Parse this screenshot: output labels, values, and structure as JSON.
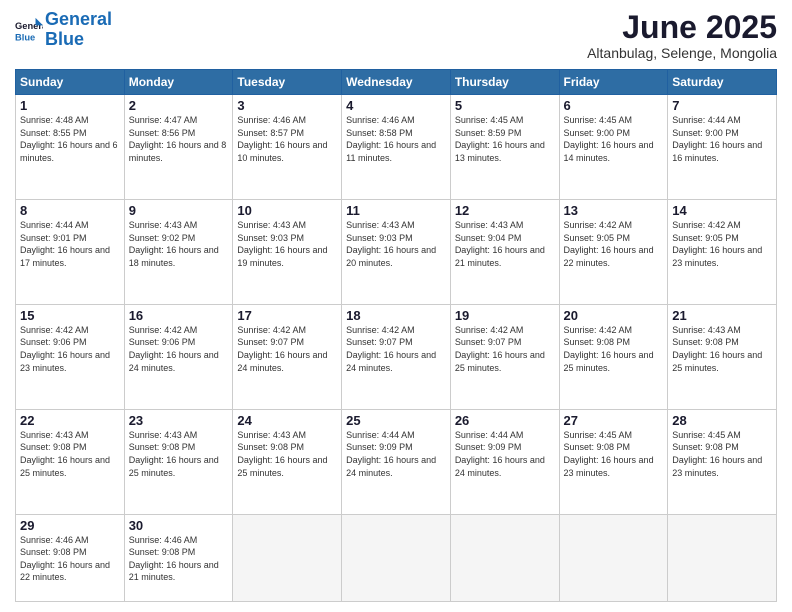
{
  "header": {
    "logo_line1": "General",
    "logo_line2": "Blue",
    "month_title": "June 2025",
    "location": "Altanbulag, Selenge, Mongolia"
  },
  "days_of_week": [
    "Sunday",
    "Monday",
    "Tuesday",
    "Wednesday",
    "Thursday",
    "Friday",
    "Saturday"
  ],
  "weeks": [
    [
      {
        "day": "1",
        "sunrise": "Sunrise: 4:48 AM",
        "sunset": "Sunset: 8:55 PM",
        "daylight": "Daylight: 16 hours and 6 minutes."
      },
      {
        "day": "2",
        "sunrise": "Sunrise: 4:47 AM",
        "sunset": "Sunset: 8:56 PM",
        "daylight": "Daylight: 16 hours and 8 minutes."
      },
      {
        "day": "3",
        "sunrise": "Sunrise: 4:46 AM",
        "sunset": "Sunset: 8:57 PM",
        "daylight": "Daylight: 16 hours and 10 minutes."
      },
      {
        "day": "4",
        "sunrise": "Sunrise: 4:46 AM",
        "sunset": "Sunset: 8:58 PM",
        "daylight": "Daylight: 16 hours and 11 minutes."
      },
      {
        "day": "5",
        "sunrise": "Sunrise: 4:45 AM",
        "sunset": "Sunset: 8:59 PM",
        "daylight": "Daylight: 16 hours and 13 minutes."
      },
      {
        "day": "6",
        "sunrise": "Sunrise: 4:45 AM",
        "sunset": "Sunset: 9:00 PM",
        "daylight": "Daylight: 16 hours and 14 minutes."
      },
      {
        "day": "7",
        "sunrise": "Sunrise: 4:44 AM",
        "sunset": "Sunset: 9:00 PM",
        "daylight": "Daylight: 16 hours and 16 minutes."
      }
    ],
    [
      {
        "day": "8",
        "sunrise": "Sunrise: 4:44 AM",
        "sunset": "Sunset: 9:01 PM",
        "daylight": "Daylight: 16 hours and 17 minutes."
      },
      {
        "day": "9",
        "sunrise": "Sunrise: 4:43 AM",
        "sunset": "Sunset: 9:02 PM",
        "daylight": "Daylight: 16 hours and 18 minutes."
      },
      {
        "day": "10",
        "sunrise": "Sunrise: 4:43 AM",
        "sunset": "Sunset: 9:03 PM",
        "daylight": "Daylight: 16 hours and 19 minutes."
      },
      {
        "day": "11",
        "sunrise": "Sunrise: 4:43 AM",
        "sunset": "Sunset: 9:03 PM",
        "daylight": "Daylight: 16 hours and 20 minutes."
      },
      {
        "day": "12",
        "sunrise": "Sunrise: 4:43 AM",
        "sunset": "Sunset: 9:04 PM",
        "daylight": "Daylight: 16 hours and 21 minutes."
      },
      {
        "day": "13",
        "sunrise": "Sunrise: 4:42 AM",
        "sunset": "Sunset: 9:05 PM",
        "daylight": "Daylight: 16 hours and 22 minutes."
      },
      {
        "day": "14",
        "sunrise": "Sunrise: 4:42 AM",
        "sunset": "Sunset: 9:05 PM",
        "daylight": "Daylight: 16 hours and 23 minutes."
      }
    ],
    [
      {
        "day": "15",
        "sunrise": "Sunrise: 4:42 AM",
        "sunset": "Sunset: 9:06 PM",
        "daylight": "Daylight: 16 hours and 23 minutes."
      },
      {
        "day": "16",
        "sunrise": "Sunrise: 4:42 AM",
        "sunset": "Sunset: 9:06 PM",
        "daylight": "Daylight: 16 hours and 24 minutes."
      },
      {
        "day": "17",
        "sunrise": "Sunrise: 4:42 AM",
        "sunset": "Sunset: 9:07 PM",
        "daylight": "Daylight: 16 hours and 24 minutes."
      },
      {
        "day": "18",
        "sunrise": "Sunrise: 4:42 AM",
        "sunset": "Sunset: 9:07 PM",
        "daylight": "Daylight: 16 hours and 24 minutes."
      },
      {
        "day": "19",
        "sunrise": "Sunrise: 4:42 AM",
        "sunset": "Sunset: 9:07 PM",
        "daylight": "Daylight: 16 hours and 25 minutes."
      },
      {
        "day": "20",
        "sunrise": "Sunrise: 4:42 AM",
        "sunset": "Sunset: 9:08 PM",
        "daylight": "Daylight: 16 hours and 25 minutes."
      },
      {
        "day": "21",
        "sunrise": "Sunrise: 4:43 AM",
        "sunset": "Sunset: 9:08 PM",
        "daylight": "Daylight: 16 hours and 25 minutes."
      }
    ],
    [
      {
        "day": "22",
        "sunrise": "Sunrise: 4:43 AM",
        "sunset": "Sunset: 9:08 PM",
        "daylight": "Daylight: 16 hours and 25 minutes."
      },
      {
        "day": "23",
        "sunrise": "Sunrise: 4:43 AM",
        "sunset": "Sunset: 9:08 PM",
        "daylight": "Daylight: 16 hours and 25 minutes."
      },
      {
        "day": "24",
        "sunrise": "Sunrise: 4:43 AM",
        "sunset": "Sunset: 9:08 PM",
        "daylight": "Daylight: 16 hours and 25 minutes."
      },
      {
        "day": "25",
        "sunrise": "Sunrise: 4:44 AM",
        "sunset": "Sunset: 9:09 PM",
        "daylight": "Daylight: 16 hours and 24 minutes."
      },
      {
        "day": "26",
        "sunrise": "Sunrise: 4:44 AM",
        "sunset": "Sunset: 9:09 PM",
        "daylight": "Daylight: 16 hours and 24 minutes."
      },
      {
        "day": "27",
        "sunrise": "Sunrise: 4:45 AM",
        "sunset": "Sunset: 9:08 PM",
        "daylight": "Daylight: 16 hours and 23 minutes."
      },
      {
        "day": "28",
        "sunrise": "Sunrise: 4:45 AM",
        "sunset": "Sunset: 9:08 PM",
        "daylight": "Daylight: 16 hours and 23 minutes."
      }
    ],
    [
      {
        "day": "29",
        "sunrise": "Sunrise: 4:46 AM",
        "sunset": "Sunset: 9:08 PM",
        "daylight": "Daylight: 16 hours and 22 minutes."
      },
      {
        "day": "30",
        "sunrise": "Sunrise: 4:46 AM",
        "sunset": "Sunset: 9:08 PM",
        "daylight": "Daylight: 16 hours and 21 minutes."
      },
      null,
      null,
      null,
      null,
      null
    ]
  ]
}
